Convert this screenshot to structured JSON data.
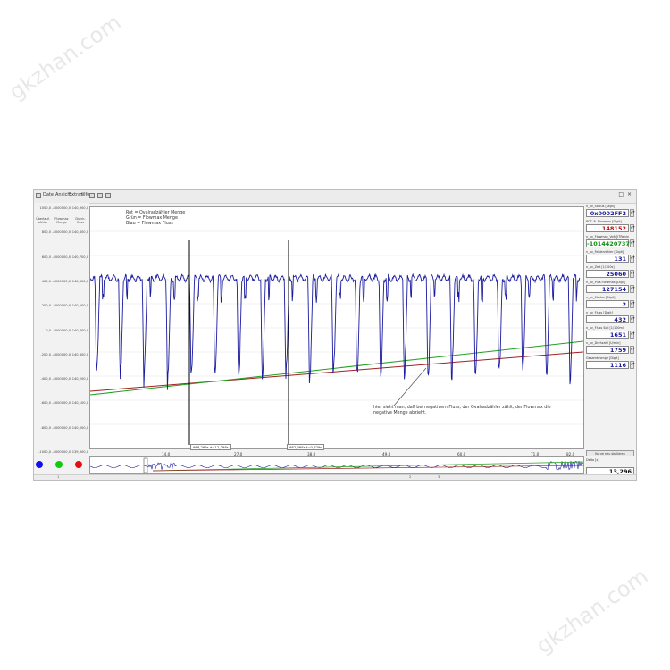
{
  "watermarks": [
    "gkzhan.com",
    "gkzhan.com"
  ],
  "toolbar": {
    "items": [
      "Datei",
      "Ansicht",
      "Extras",
      "Hilfe"
    ],
    "window_controls": "_ □ ×"
  },
  "y_axis": {
    "headers": [
      "Überlauf-\nzähler",
      "Flowmax\nMenge",
      "Durch-\nfluss"
    ],
    "col1": [
      "1000,0",
      "800,0",
      "600,0",
      "400,0",
      "200,0",
      "0,0",
      "-200,0",
      "-400,0",
      "-600,0",
      "-800,0",
      "-1000,0"
    ],
    "col2": [
      "-4000000,0",
      "-4000000,0",
      "-4000000,0",
      "-4000000,0",
      "-4000000,0",
      "-4000000,0",
      "-4000000,0",
      "-4000000,0",
      "-4000000,0",
      "-4000000,0",
      "-4000000,0"
    ],
    "col3": [
      "140,900,0",
      "140,800,0",
      "140,700,0",
      "140,600,0",
      "140,500,0",
      "140,400,0",
      "140,300,0",
      "140,200,0",
      "140,100,0",
      "140,000,0",
      "139,900,0"
    ]
  },
  "legend": [
    "Rot = Ovalradzähler Menge",
    "Grün = Flowmax Menge",
    "Blau = Flowmax Fluss"
  ],
  "annotation": "hier sieht man, daß bei negativem Fluss, der Ovalradzähler zählt, der Flowmax die negative Menge abzieht.",
  "cursors": [
    {
      "label": "968,269s  d=12,298s"
    },
    {
      "label": "982,068s  t=0,679s"
    }
  ],
  "x_ticks": [
    "14,0",
    "27,0",
    "38,0",
    "49,0",
    "60,0",
    "71,0",
    "82,0"
  ],
  "colors": {
    "red": "#a02020",
    "green": "#20a020",
    "blue": "#1a1aa0",
    "dot_blue": "#1010ee",
    "dot_green": "#10cc10",
    "dot_red": "#e01010"
  },
  "status": [
    "1",
    "2",
    "3"
  ],
  "right_panel": [
    {
      "label": "n_ov_Status [Digit]",
      "value": "0x0002FF2",
      "color": "#1a1aa0"
    },
    {
      "label": "POT. R. Flowmax [Digit]",
      "value": "148152",
      "color": "#c01010"
    },
    {
      "label": "n_ov_Flowmax_Volt [ITRenInl]",
      "value": "-1014420737",
      "color": "#109010"
    },
    {
      "label": "n_ov_Fehlerzähler [Digit]",
      "value": "131",
      "color": "#1a1aa0"
    },
    {
      "label": "n_ov_Zeit [1/100s]",
      "value": "25060",
      "color": "#1a1aa0"
    },
    {
      "label": "n_ov_Puls Flowmax [Digit]",
      "value": "127154",
      "color": "#1a1aa0"
    },
    {
      "label": "n_ov_Modus [Digit]",
      "value": "2",
      "color": "#1a1aa0"
    },
    {
      "label": "n_ov_Fluss [Digit]",
      "value": "432",
      "color": "#1a1aa0"
    },
    {
      "label": "n_ov_Fluss Soll [1/100ml]",
      "value": "1651",
      "color": "#1a1aa0"
    },
    {
      "label": "n_ov_Drehzahl [U/min]",
      "value": "1759",
      "color": "#1a1aa0"
    },
    {
      "label": "Gesamtmenge [Digit]",
      "value": "1116",
      "color": "#1a1aa0"
    }
  ],
  "right_panel_button": "Kurve neu skalieren",
  "cursor_panel": {
    "label": "Delta [s]",
    "value": "13,296"
  }
}
